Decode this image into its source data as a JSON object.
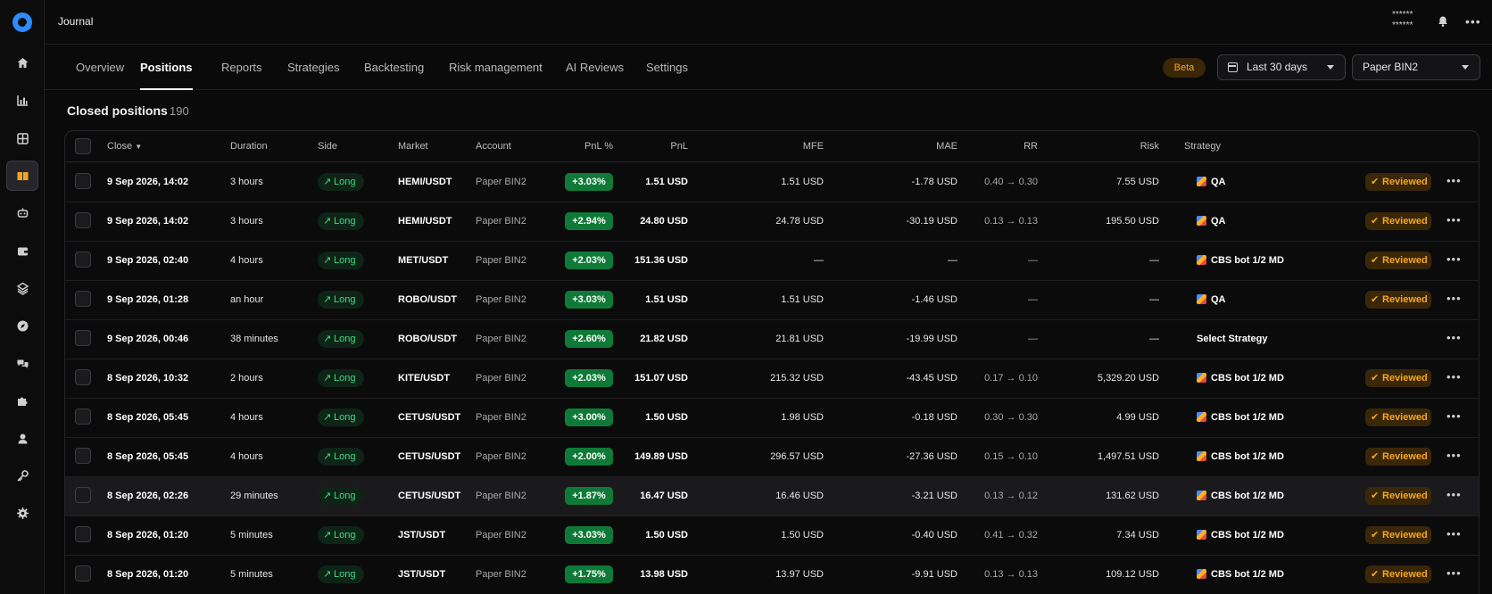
{
  "app": {
    "title": "Journal",
    "masked_user": [
      "******",
      "******"
    ]
  },
  "tabs": [
    {
      "label": "Overview"
    },
    {
      "label": "Positions"
    },
    {
      "label": "Reports"
    },
    {
      "label": "Strategies"
    },
    {
      "label": "Backtesting"
    },
    {
      "label": "Risk management"
    },
    {
      "label": "AI Reviews"
    },
    {
      "label": "Settings"
    }
  ],
  "active_tab": "Positions",
  "toolbar": {
    "beta_label": "Beta",
    "date_range": "Last 30 days",
    "account": "Paper BIN2"
  },
  "section": {
    "title": "Closed positions",
    "count": "190"
  },
  "table": {
    "columns": [
      "Close",
      "Duration",
      "Side",
      "Market",
      "Account",
      "PnL %",
      "PnL",
      "MFE",
      "MAE",
      "RR",
      "Risk",
      "Strategy"
    ],
    "rows": [
      {
        "close": "9 Sep 2026, 14:02",
        "duration": "3 hours",
        "side": "Long",
        "market": "HEMI/USDT",
        "account": "Paper BIN2",
        "pnl_pct": "+3.03%",
        "pnl": "1.51 USD",
        "mfe": "1.51 USD",
        "mae": "-1.78 USD",
        "rr": "0.40 → 0.30",
        "risk": "7.55 USD",
        "strategy": "QA",
        "reviewed": "Reviewed"
      },
      {
        "close": "9 Sep 2026, 14:02",
        "duration": "3 hours",
        "side": "Long",
        "market": "HEMI/USDT",
        "account": "Paper BIN2",
        "pnl_pct": "+2.94%",
        "pnl": "24.80 USD",
        "mfe": "24.78 USD",
        "mae": "-30.19 USD",
        "rr": "0.13 → 0.13",
        "risk": "195.50 USD",
        "strategy": "QA",
        "reviewed": "Reviewed"
      },
      {
        "close": "9 Sep 2026, 02:40",
        "duration": "4 hours",
        "side": "Long",
        "market": "MET/USDT",
        "account": "Paper BIN2",
        "pnl_pct": "+2.03%",
        "pnl": "151.36 USD",
        "mfe": "—",
        "mae": "—",
        "rr": "—",
        "risk": "—",
        "strategy": "CBS bot 1/2 MD",
        "reviewed": "Reviewed"
      },
      {
        "close": "9 Sep 2026, 01:28",
        "duration": "an hour",
        "side": "Long",
        "market": "ROBO/USDT",
        "account": "Paper BIN2",
        "pnl_pct": "+3.03%",
        "pnl": "1.51 USD",
        "mfe": "1.51 USD",
        "mae": "-1.46 USD",
        "rr": "—",
        "risk": "—",
        "strategy": "QA",
        "reviewed": "Reviewed"
      },
      {
        "close": "9 Sep 2026, 00:46",
        "duration": "38 minutes",
        "side": "Long",
        "market": "ROBO/USDT",
        "account": "Paper BIN2",
        "pnl_pct": "+2.60%",
        "pnl": "21.82 USD",
        "mfe": "21.81 USD",
        "mae": "-19.99 USD",
        "rr": "—",
        "risk": "—",
        "strategy": "Select Strategy",
        "reviewed": ""
      },
      {
        "close": "8 Sep 2026, 10:32",
        "duration": "2 hours",
        "side": "Long",
        "market": "KITE/USDT",
        "account": "Paper BIN2",
        "pnl_pct": "+2.03%",
        "pnl": "151.07 USD",
        "mfe": "215.32 USD",
        "mae": "-43.45 USD",
        "rr": "0.17 → 0.10",
        "risk": "5,329.20 USD",
        "strategy": "CBS bot 1/2 MD",
        "reviewed": "Reviewed"
      },
      {
        "close": "8 Sep 2026, 05:45",
        "duration": "4 hours",
        "side": "Long",
        "market": "CETUS/USDT",
        "account": "Paper BIN2",
        "pnl_pct": "+3.00%",
        "pnl": "1.50 USD",
        "mfe": "1.98 USD",
        "mae": "-0.18 USD",
        "rr": "0.30 → 0.30",
        "risk": "4.99 USD",
        "strategy": "CBS bot 1/2 MD",
        "reviewed": "Reviewed"
      },
      {
        "close": "8 Sep 2026, 05:45",
        "duration": "4 hours",
        "side": "Long",
        "market": "CETUS/USDT",
        "account": "Paper BIN2",
        "pnl_pct": "+2.00%",
        "pnl": "149.89 USD",
        "mfe": "296.57 USD",
        "mae": "-27.36 USD",
        "rr": "0.15 → 0.10",
        "risk": "1,497.51 USD",
        "strategy": "CBS bot 1/2 MD",
        "reviewed": "Reviewed"
      },
      {
        "close": "8 Sep 2026, 02:26",
        "duration": "29 minutes",
        "side": "Long",
        "market": "CETUS/USDT",
        "account": "Paper BIN2",
        "pnl_pct": "+1.87%",
        "pnl": "16.47 USD",
        "mfe": "16.46 USD",
        "mae": "-3.21 USD",
        "rr": "0.13 → 0.12",
        "risk": "131.62 USD",
        "strategy": "CBS bot 1/2 MD",
        "reviewed": "Reviewed"
      },
      {
        "close": "8 Sep 2026, 01:20",
        "duration": "5 minutes",
        "side": "Long",
        "market": "JST/USDT",
        "account": "Paper BIN2",
        "pnl_pct": "+3.03%",
        "pnl": "1.50 USD",
        "mfe": "1.50 USD",
        "mae": "-0.40 USD",
        "rr": "0.41 → 0.32",
        "risk": "7.34 USD",
        "strategy": "CBS bot 1/2 MD",
        "reviewed": "Reviewed"
      },
      {
        "close": "8 Sep 2026, 01:20",
        "duration": "5 minutes",
        "side": "Long",
        "market": "JST/USDT",
        "account": "Paper BIN2",
        "pnl_pct": "+1.75%",
        "pnl": "13.98 USD",
        "mfe": "13.97 USD",
        "mae": "-9.91 USD",
        "rr": "0.13 → 0.13",
        "risk": "109.12 USD",
        "strategy": "CBS bot 1/2 MD",
        "reviewed": "Reviewed"
      }
    ]
  },
  "icons": {
    "sidebar": [
      "home-icon",
      "chart-icon",
      "grid-icon",
      "journal-icon",
      "bot-icon",
      "wallet-icon",
      "layers-icon",
      "compass-icon",
      "chat-icon",
      "puzzle-icon",
      "support-icon",
      "key-icon",
      "settings-icon"
    ],
    "active_sidebar": "journal-icon"
  },
  "colors": {
    "accent": "#2d8cff",
    "profit": "#0f7a37",
    "long": "#3ddc84",
    "reviewed": "#f5a623"
  }
}
